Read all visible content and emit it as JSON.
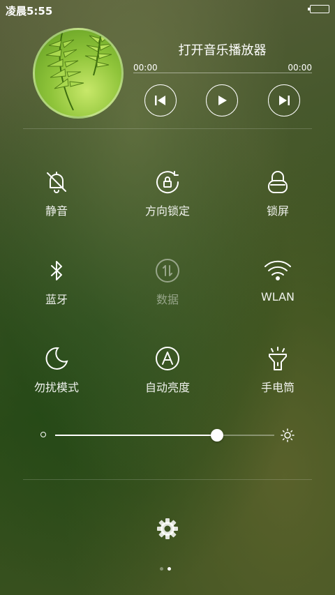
{
  "status_bar": {
    "time": "凌晨5:55"
  },
  "music": {
    "title": "打开音乐播放器",
    "elapsed": "00:00",
    "total": "00:00",
    "progress": 0
  },
  "toggles": [
    {
      "label": "静音",
      "icon": "bell-off-icon"
    },
    {
      "label": "方向锁定",
      "icon": "rotation-lock-icon"
    },
    {
      "label": "锁屏",
      "icon": "lock-icon"
    },
    {
      "label": "蓝牙",
      "icon": "bluetooth-icon"
    },
    {
      "label": "数据",
      "icon": "mobile-data-icon",
      "disabled": true
    },
    {
      "label": "WLAN",
      "icon": "wifi-icon"
    },
    {
      "label": "勿扰模式",
      "icon": "moon-icon"
    },
    {
      "label": "自动亮度",
      "icon": "auto-brightness-icon"
    },
    {
      "label": "手电筒",
      "icon": "flashlight-icon"
    }
  ],
  "brightness": {
    "level": 0.74
  },
  "pager": {
    "count": 2,
    "active": 1
  },
  "colors": {
    "accent": "#ffffff",
    "background": "#3f5524"
  }
}
